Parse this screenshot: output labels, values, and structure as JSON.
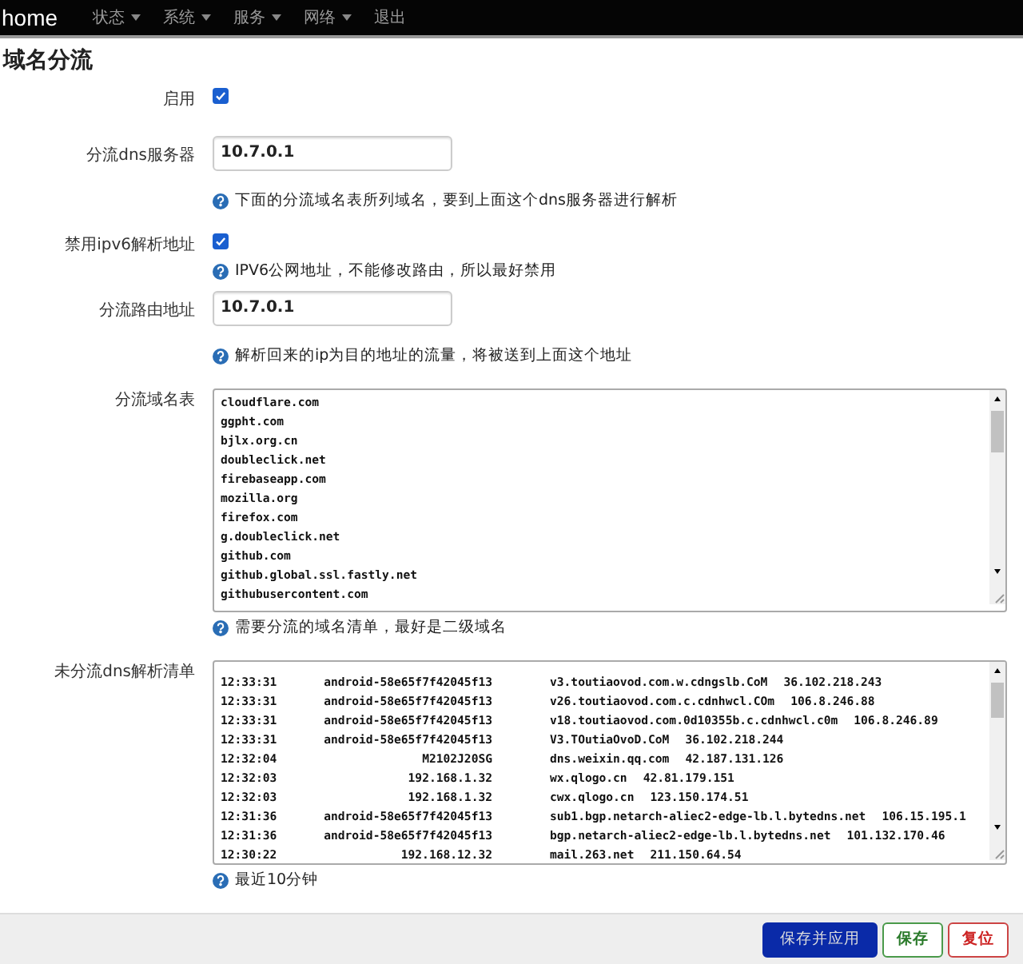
{
  "navbar": {
    "brand": "home",
    "menus": [
      {
        "label": "状态",
        "dropdown": true
      },
      {
        "label": "系统",
        "dropdown": true
      },
      {
        "label": "服务",
        "dropdown": true
      },
      {
        "label": "网络",
        "dropdown": true
      },
      {
        "label": "退出",
        "dropdown": false
      }
    ]
  },
  "title": "域名分流",
  "fields": [
    {
      "kind": "checkbox",
      "label": "启用",
      "checked": true
    },
    {
      "kind": "text",
      "label": "分流dns服务器",
      "value": "10.7.0.1",
      "hint": "下面的分流域名表所列域名，要到上面这个dns服务器进行解析"
    },
    {
      "kind": "checkbox",
      "label": "禁用ipv6解析地址",
      "checked": true,
      "hint": "IPV6公网地址，不能修改路由，所以最好禁用"
    },
    {
      "kind": "text",
      "label": "分流路由地址",
      "value": "10.7.0.1",
      "hint": "解析回来的ip为目的地址的流量，将被送到上面这个地址"
    },
    {
      "kind": "domains",
      "label": "分流域名表",
      "lines": [
        "cloudflare.com",
        "ggpht.com",
        "bjlx.org.cn",
        "doubleclick.net",
        "firebaseapp.com",
        "mozilla.org",
        "firefox.com",
        "g.doubleclick.net",
        "github.com",
        "github.global.ssl.fastly.net",
        "githubusercontent.com"
      ],
      "hint": "需要分流的域名清单，最好是二级域名"
    },
    {
      "kind": "log",
      "label": "未分流dns解析清单",
      "rows": [
        {
          "time": "12:33:31",
          "host": "android-58e65f7f42045f13",
          "domain": "v3.toutiaovod.com.w.cdngslb.CoM",
          "ip": "36.102.218.243"
        },
        {
          "time": "12:33:31",
          "host": "android-58e65f7f42045f13",
          "domain": "v26.toutiaovod.com.c.cdnhwcl.COm",
          "ip": "106.8.246.88"
        },
        {
          "time": "12:33:31",
          "host": "android-58e65f7f42045f13",
          "domain": "v18.toutiaovod.com.0d10355b.c.cdnhwcl.c0m",
          "ip": "106.8.246.89"
        },
        {
          "time": "12:33:31",
          "host": "android-58e65f7f42045f13",
          "domain": "V3.TOutiaOvoD.CoM",
          "ip": "36.102.218.244"
        },
        {
          "time": "12:32:04",
          "host": "M2102J20SG",
          "domain": "dns.weixin.qq.com",
          "ip": "42.187.131.126"
        },
        {
          "time": "12:32:03",
          "host": "192.168.1.32",
          "domain": "wx.qlogo.cn",
          "ip": "42.81.179.151"
        },
        {
          "time": "12:32:03",
          "host": "192.168.1.32",
          "domain": "cwx.qlogo.cn",
          "ip": "123.150.174.51"
        },
        {
          "time": "12:31:36",
          "host": "android-58e65f7f42045f13",
          "domain": "sub1.bgp.netarch-aliec2-edge-lb.l.bytedns.net",
          "ip": "106.15.195.1"
        },
        {
          "time": "12:31:36",
          "host": "android-58e65f7f42045f13",
          "domain": "bgp.netarch-aliec2-edge-lb.l.bytedns.net",
          "ip": "101.132.170.46"
        },
        {
          "time": "12:30:22",
          "host": "192.168.12.32",
          "domain": "mail.263.net",
          "ip": "211.150.64.54"
        }
      ],
      "hint": "最近10分钟"
    }
  ],
  "buttons": [
    {
      "kind": "apply",
      "label": "保存并应用"
    },
    {
      "kind": "save",
      "label": "保存"
    },
    {
      "kind": "reset",
      "label": "复位"
    }
  ]
}
